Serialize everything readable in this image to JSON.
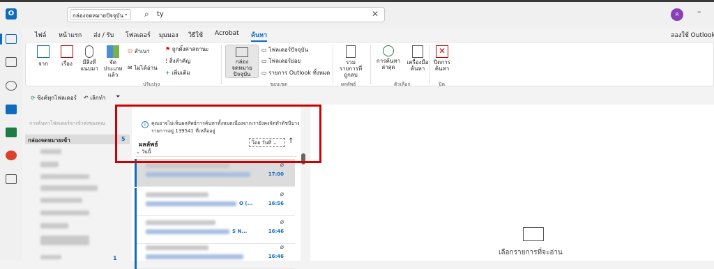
{
  "search": {
    "scope": "กล่องจดหมายปัจจุบัน",
    "query": "ty"
  },
  "account": {
    "avatar": "R"
  },
  "tabs": [
    "ไฟล์",
    "หน้าแรก",
    "ส่ง / รับ",
    "โฟลเดอร์",
    "มุมมอง",
    "วิธีใช้",
    "Acrobat",
    "ค้นหา"
  ],
  "try_outlook": "ลองใช้ Outlook",
  "ribbon": {
    "from": "จาก",
    "subject": "เรื่อง",
    "has_attachment": "มีสิ่งที่แนบมา",
    "categorized": "จัดประเภทแล้ว",
    "cc": "สำเนา",
    "unread": "ไม่ได้อ่าน",
    "flagged": "ถูกตั้งค่าสถานะ",
    "important": "สิ่งสำคัญ",
    "more": "เพิ่มเติม",
    "current_mailbox": "กล่องจดหมายปัจจุบัน",
    "current_folder": "โฟลเดอร์ปัจจุบัน",
    "subfolders": "โฟลเดอร์ย่อย",
    "all_outlook_items": "รายการ Outlook ทั้งหมด",
    "include_deleted": "รวมรายการที่ถูกลบ",
    "recent_searches": "การค้นหาล่าสุด",
    "search_tools": "เครื่องมือค้นหา",
    "close_search": "ปิดการค้นหา",
    "group_refine": "ปรับปรุง",
    "group_scope": "ขอบเขต",
    "group_results": "ผลลัพธ์",
    "group_options": "ตัวเลือก",
    "group_close": "ปิด"
  },
  "toolbar2": {
    "sync": "ซิงค์ทุกโฟลเดอร์",
    "undo": "เลิกทำ"
  },
  "folders": {
    "search_placeholder": "การค้นหาโฟลเดอร์ขาเข้าส่งของคุณ",
    "inbox": "กล่องจดหมายเข้า",
    "inbox_count": "5",
    "bottom_count": "1"
  },
  "results": {
    "banner": "คุณอาจไม่เห็นผลลัพธ์การค้นหาทั้งหมดเนื่องจากเรายังคงจัดทำดัชนีบางรายการอยู่ 139541 ที่เหลืออยู่",
    "label": "ผลลัพธ์",
    "sort": "โดย วันที่",
    "group": "วันนี้",
    "messages": [
      {
        "time": "17:00"
      },
      {
        "subject": "O (...",
        "time": "16:56"
      },
      {
        "subject": "S N...",
        "time": "16:46"
      },
      {
        "time": "16:46"
      }
    ]
  },
  "reading": {
    "empty": "เลือกรายการที่จะอ่าน"
  }
}
